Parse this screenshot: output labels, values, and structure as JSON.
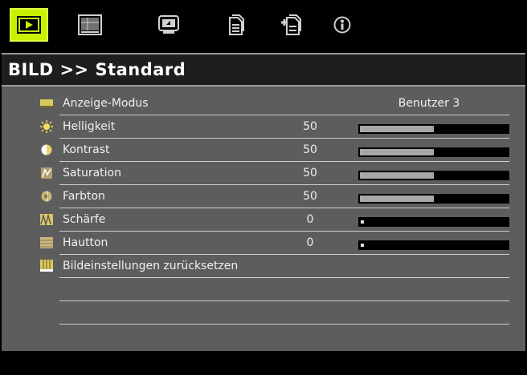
{
  "colors": {
    "active_tab": "#c8f000",
    "content_bg": "#5d5d5d",
    "slider_fill": "#a8a8a8",
    "text": "#f0f0f0"
  },
  "tabs": [
    {
      "icon": "picture-play-icon",
      "active": true
    },
    {
      "icon": "screen-grid-icon",
      "active": false
    },
    {
      "icon": "monitor-settings-icon",
      "active": false
    },
    {
      "icon": "document-icon",
      "active": false
    },
    {
      "icon": "document-plus-icon",
      "active": false
    },
    {
      "icon": "info-circle-icon",
      "active": false
    }
  ],
  "header": {
    "title": "BILD >> Standard"
  },
  "menu": {
    "items": [
      {
        "icon": "display-mode-icon",
        "label": "Anzeige-Modus",
        "select_value": "Benutzer 3"
      },
      {
        "icon": "brightness-icon",
        "label": "Helligkeit",
        "value": "50",
        "level": 0.5
      },
      {
        "icon": "contrast-icon",
        "label": "Kontrast",
        "value": "50",
        "level": 0.5
      },
      {
        "icon": "saturation-icon",
        "label": "Saturation",
        "value": "50",
        "level": 0.5
      },
      {
        "icon": "tint-icon",
        "label": "Farbton",
        "value": "50",
        "level": 0.5
      },
      {
        "icon": "sharpness-icon",
        "label": "Schärfe",
        "value": "0",
        "level": 0
      },
      {
        "icon": "skin-tone-icon",
        "label": "Hautton",
        "value": "0",
        "level": 0
      },
      {
        "icon": "reset-icon",
        "label": "Bildeinstellungen zurücksetzen"
      }
    ]
  }
}
